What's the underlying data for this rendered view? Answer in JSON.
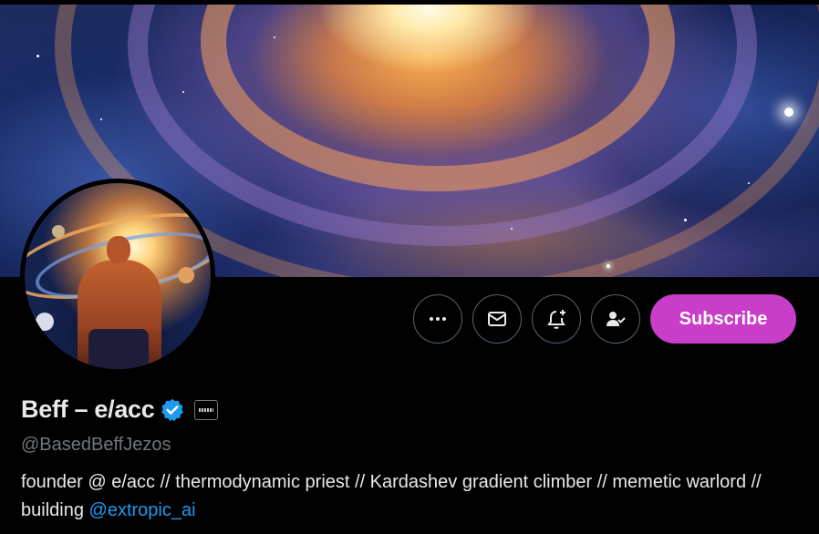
{
  "profile": {
    "display_name": "Beff – e/acc",
    "handle": "@BasedBeffJezos",
    "bio_text": "founder @ e/acc // thermodynamic priest // Kardashev gradient climber // memetic warlord // building ",
    "bio_mention": "@extropic_ai"
  },
  "actions": {
    "subscribe_label": "Subscribe"
  },
  "icons": {
    "more": "more-icon",
    "message": "mail-icon",
    "notify": "bell-plus-icon",
    "following": "person-check-icon",
    "verified": "verified-badge-icon",
    "affiliation": "affiliation-badge-icon"
  },
  "colors": {
    "background": "#000000",
    "subscribe": "#c93ec8",
    "mention": "#1d9bf0",
    "verified": "#1d9bf0",
    "secondary_text": "#71767b"
  }
}
